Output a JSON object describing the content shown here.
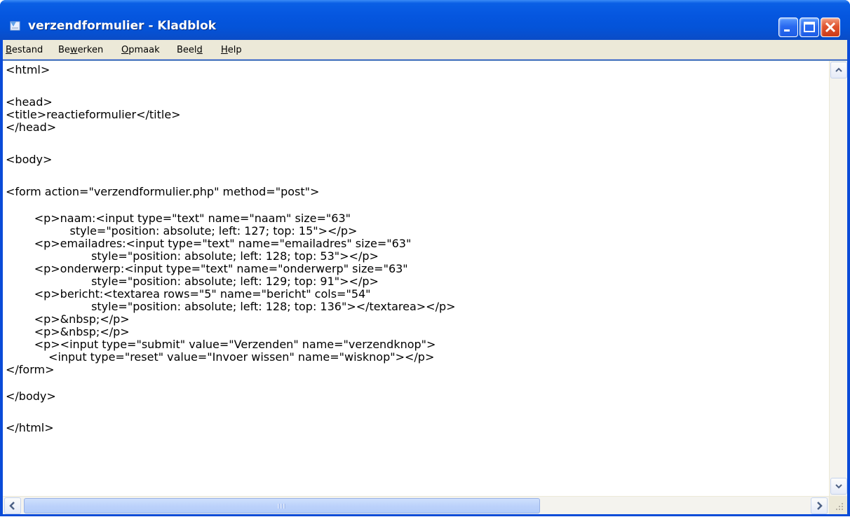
{
  "window": {
    "title": "verzendformulier - Kladblok"
  },
  "menu": {
    "items": [
      {
        "pre": "",
        "key": "B",
        "post": "estand"
      },
      {
        "pre": "Be",
        "key": "w",
        "post": "erken"
      },
      {
        "pre": "",
        "key": "O",
        "post": "pmaak"
      },
      {
        "pre": "Beel",
        "key": "d",
        "post": ""
      },
      {
        "pre": "",
        "key": "H",
        "post": "elp"
      }
    ]
  },
  "document": {
    "lines": [
      "<html>",
      "",
      "<head>",
      "<title>reactieformulier</title>",
      "</head>",
      "",
      "<body>",
      "",
      "<form action=\"verzendformulier.php\" method=\"post\">",
      "",
      "\t<p>naam:<input type=\"text\" name=\"naam\" size=\"63\"",
      "\t\t  style=\"position: absolute; left: 127; top: 15\"></p>",
      "\t<p>emailadres:<input type=\"text\" name=\"emailadres\" size=\"63\"",
      "\t\t\tstyle=\"position: absolute; left: 128; top: 53\"></p>",
      "\t<p>onderwerp:<input type=\"text\" name=\"onderwerp\" size=\"63\"",
      "\t\t\tstyle=\"position: absolute; left: 129; top: 91\"></p>",
      "\t<p>bericht:<textarea rows=\"5\" name=\"bericht\" cols=\"54\"",
      "\t\t\tstyle=\"position: absolute; left: 128; top: 136\"></textarea></p>",
      "\t<p>&nbsp;</p>",
      "\t<p>&nbsp;</p>",
      "\t<p><input type=\"submit\" value=\"Verzenden\" name=\"verzendknop\">",
      "\t    <input type=\"reset\" value=\"Invoer wissen\" name=\"wisknop\"></p>",
      "</form>",
      "",
      "</body>",
      "",
      "</html>"
    ]
  },
  "icons": {
    "app": "notepad-icon",
    "minimize": "minimize-icon",
    "maximize": "maximize-icon",
    "close": "close-icon",
    "scroll_up": "chevron-up-icon",
    "scroll_down": "chevron-down-icon",
    "scroll_left": "chevron-left-icon",
    "scroll_right": "chevron-right-icon"
  },
  "colors": {
    "titlebar": "#0554de",
    "frame": "#0a4bd8",
    "menubar": "#ece9d8",
    "close_button": "#e0542f",
    "scroll_thumb": "#bcd2fb"
  }
}
